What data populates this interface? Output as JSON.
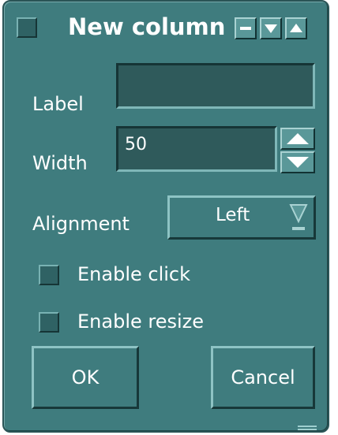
{
  "window": {
    "title": "New column"
  },
  "title_buttons": [
    "minimize-icon",
    "shade-down-icon",
    "maximize-up-icon"
  ],
  "form": {
    "label_caption": "Label",
    "label_value": "",
    "width_caption": "Width",
    "width_value": "50",
    "alignment_caption": "Alignment",
    "alignment_value": "Left"
  },
  "options": {
    "enable_click": "Enable click",
    "enable_resize": "Enable resize",
    "enable_click_checked": false,
    "enable_resize_checked": false
  },
  "buttons": {
    "ok": "OK",
    "cancel": "Cancel"
  },
  "colors": {
    "window_bg": "#3f7c7e",
    "field_bg": "#2f5a5b",
    "text": "#ffffff"
  }
}
